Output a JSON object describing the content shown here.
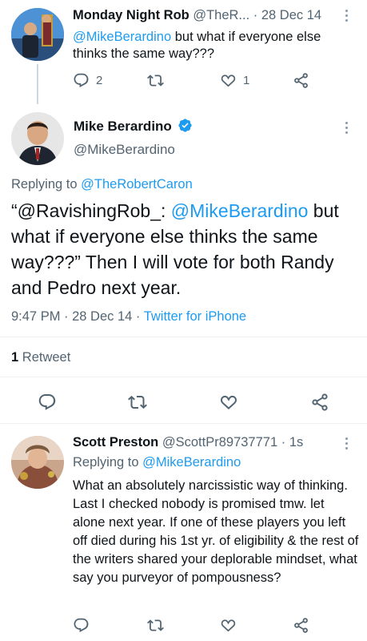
{
  "tweet1": {
    "name": "Monday Night Rob",
    "handle": "@TheR...",
    "sep": "·",
    "date": "28 Dec 14",
    "mention": "@MikeBerardino",
    "text": " but what if everyone else thinks the same way???",
    "reply_count": "2",
    "like_count": "1"
  },
  "tweet2": {
    "name": "Mike Berardino",
    "handle": "@MikeBerardino",
    "replying_prefix": "Replying to ",
    "replying_to": "@TheRobertCaron",
    "text_open": "“@RavishingRob_: ",
    "mention": "@MikeBerardino",
    "text_rest": " but what if everyone else thinks the same way???” Then I will vote for both Randy and Pedro next year.",
    "time": "9:47 PM · 28 Dec 14 · ",
    "source": "Twitter for iPhone",
    "retweet_count": "1",
    "retweet_label": " Retweet"
  },
  "tweet3": {
    "name": "Scott Preston",
    "handle": "@ScottPr89737771",
    "sep": "·",
    "time": "1s",
    "replying_prefix": "Replying to ",
    "replying_to": "@MikeBerardino",
    "text": "What an absolutely narcissistic way of thinking. Last I checked nobody is promised tmw. let alone next year. If one of these players you left off died during his 1st yr. of eligibility & the rest of the writers shared your deplorable mindset, what say you purveyor of pompousness?"
  },
  "icons": {
    "reply": "reply-icon",
    "retweet": "retweet-icon",
    "like": "heart-icon",
    "share": "share-icon",
    "verified": "verified-badge-icon",
    "more": "more-icon"
  },
  "colors": {
    "accent": "#1d9bf0",
    "text": "#0f1419",
    "secondary": "#536471",
    "divider": "#eff3f4"
  }
}
